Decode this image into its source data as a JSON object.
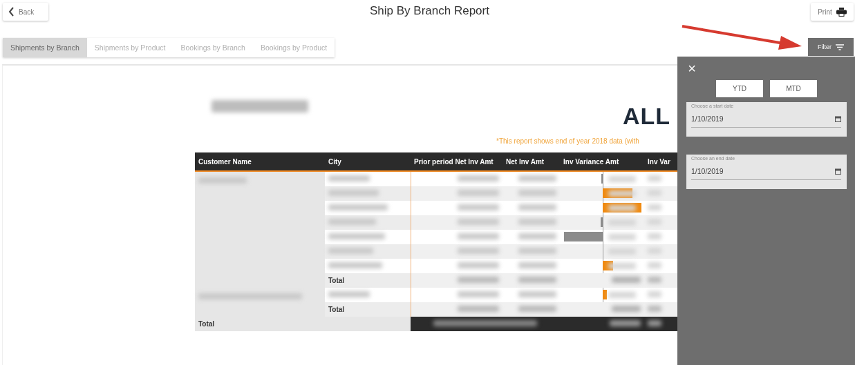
{
  "header": {
    "back": "Back",
    "title": "Ship By Branch Report",
    "print": "Print"
  },
  "tabs": [
    {
      "label": "Shipments by Branch",
      "selected": true
    },
    {
      "label": "Shipments by Product",
      "selected": false
    },
    {
      "label": "Bookings by Branch",
      "selected": false
    },
    {
      "label": "Bookings by Product",
      "selected": false
    }
  ],
  "filter_button": "Filter",
  "report": {
    "heading": "ALL",
    "note": "*This report shows end of year 2018 data (with",
    "columns": [
      "Customer Name",
      "City",
      "Prior period Net Inv Amt",
      "Net Inv Amt",
      "Inv Variance Amt",
      "Inv Var"
    ],
    "groups": [
      {
        "rows": [
          {
            "kind": "negative"
          },
          {
            "kind": "positive"
          },
          {
            "kind": "positive"
          },
          {
            "kind": "negative"
          },
          {
            "kind": "negative"
          },
          {
            "kind": "empty"
          },
          {
            "kind": "positive"
          }
        ],
        "total_label": "Total"
      },
      {
        "rows": [
          {
            "kind": "positive"
          }
        ],
        "total_label": "Total"
      }
    ],
    "grand_total_label": "Total"
  },
  "filter_panel": {
    "close": "×",
    "presets": [
      {
        "label": "YTD"
      },
      {
        "label": "MTD"
      }
    ],
    "date_fields": [
      {
        "label": "Choose a start date",
        "value": "1/10/2019"
      },
      {
        "label": "Choose an end date",
        "value": "1/10/2019"
      }
    ]
  }
}
